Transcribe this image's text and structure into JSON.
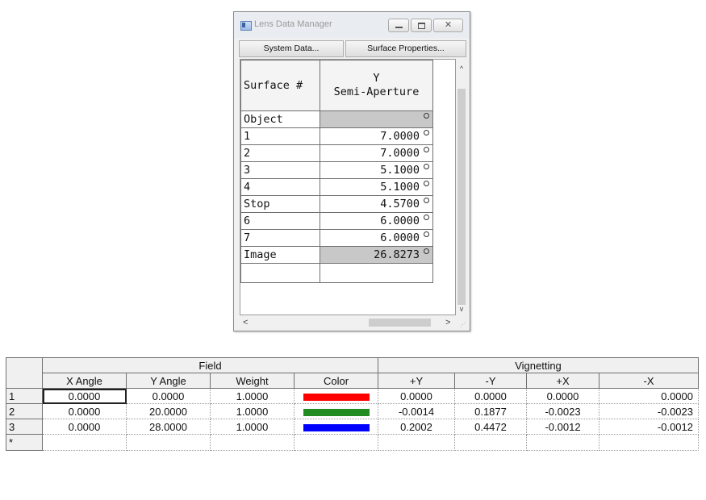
{
  "window": {
    "title": "Lens Data Manager",
    "buttons": {
      "minimize": "",
      "maximize": "",
      "close": "✕"
    }
  },
  "toolbar": {
    "system_data": "System Data...",
    "surface_properties": "Surface Properties..."
  },
  "lens_grid": {
    "headers": {
      "surface": "Surface #",
      "y_line1": "Y",
      "y_line2": "Semi-Aperture"
    },
    "rows": [
      {
        "surface": "Object",
        "value": ""
      },
      {
        "surface": "1",
        "value": "7.0000"
      },
      {
        "surface": "2",
        "value": "7.0000"
      },
      {
        "surface": "3",
        "value": "5.1000"
      },
      {
        "surface": "4",
        "value": "5.1000"
      },
      {
        "surface": "Stop",
        "value": "4.5700"
      },
      {
        "surface": "6",
        "value": "6.0000"
      },
      {
        "surface": "7",
        "value": "6.0000"
      },
      {
        "surface": "Image",
        "value": "26.8273"
      }
    ]
  },
  "scroll": {
    "up": "^",
    "down": "v",
    "left": "<",
    "right": ">"
  },
  "field_table": {
    "group_field": "Field",
    "group_vignetting": "Vignetting",
    "columns": [
      "X Angle",
      "Y Angle",
      "Weight",
      "Color",
      "+Y",
      "-Y",
      "+X",
      "-X"
    ],
    "rows": [
      {
        "label": "1",
        "x_angle": "0.0000",
        "y_angle": "0.0000",
        "weight": "1.0000",
        "color": "#ff0000",
        "py": "0.0000",
        "my": "0.0000",
        "px": "0.0000",
        "mx": "0.0000"
      },
      {
        "label": "2",
        "x_angle": "0.0000",
        "y_angle": "20.0000",
        "weight": "1.0000",
        "color": "#228b22",
        "py": "-0.0014",
        "my": "0.1877",
        "px": "-0.0023",
        "mx": "-0.0023"
      },
      {
        "label": "3",
        "x_angle": "0.0000",
        "y_angle": "28.0000",
        "weight": "1.0000",
        "color": "#0000ff",
        "py": "0.2002",
        "my": "0.4472",
        "px": "-0.0012",
        "mx": "-0.0012"
      }
    ],
    "new_row_label": "*"
  }
}
